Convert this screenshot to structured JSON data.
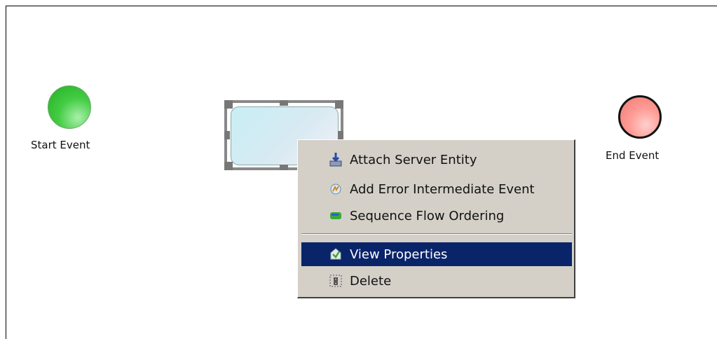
{
  "diagram": {
    "start_event": {
      "label": "Start Event",
      "color": "#33c033"
    },
    "end_event": {
      "label": "End Event",
      "color": "#ff8c86"
    },
    "task": {
      "selected": true,
      "fill": "#c8eef5"
    }
  },
  "context_menu": {
    "items": [
      {
        "label": "Attach Server Entity",
        "icon": "attach-server-icon"
      },
      {
        "label": "Add Error Intermediate Event",
        "icon": "error-event-icon"
      },
      {
        "label": "Sequence Flow Ordering",
        "icon": "sequence-flow-icon"
      },
      {
        "label": "View Properties",
        "icon": "properties-icon",
        "highlighted": true
      },
      {
        "label": "Delete",
        "icon": "delete-icon"
      }
    ],
    "highlight_color": "#0a246a"
  }
}
